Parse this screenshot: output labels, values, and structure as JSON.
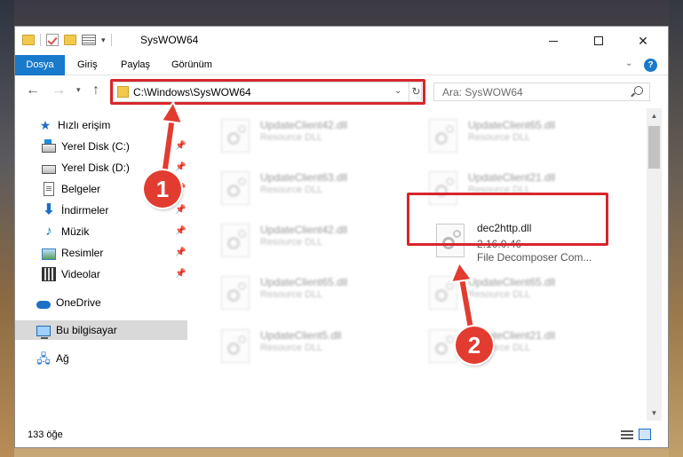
{
  "window": {
    "title": "SysWOW64",
    "controls": {
      "minimize": "minimize",
      "maximize": "maximize",
      "close": "close"
    }
  },
  "ribbon": {
    "tabs": [
      {
        "label": "Dosya"
      },
      {
        "label": "Giriş"
      },
      {
        "label": "Paylaş"
      },
      {
        "label": "Görünüm"
      }
    ],
    "help": "?"
  },
  "nav": {
    "address": "C:\\Windows\\SysWOW64",
    "search_placeholder": "Ara: SysWOW64"
  },
  "sidebar": {
    "items": [
      {
        "label": "Hızlı erişim"
      },
      {
        "label": "Yerel Disk (C:)"
      },
      {
        "label": "Yerel Disk (D:)"
      },
      {
        "label": "Belgeler"
      },
      {
        "label": "İndirmeler"
      },
      {
        "label": "Müzik"
      },
      {
        "label": "Resimler"
      },
      {
        "label": "Videolar"
      },
      {
        "label": "OneDrive"
      },
      {
        "label": "Bu bilgisayar"
      },
      {
        "label": "Ağ"
      }
    ]
  },
  "files": [
    {
      "name": "UpdateClient42.dll",
      "type": "Resource DLL"
    },
    {
      "name": "UpdateClient65.dll",
      "type": "Resource DLL"
    },
    {
      "name": "UpdateClient63.dll",
      "type": "Resource DLL"
    },
    {
      "name": "UpdateClient21.dll",
      "type": "Resource DLL"
    },
    {
      "name": "UpdateClient42.dll",
      "type": "Resource DLL"
    },
    {
      "name": "dec2http.dll",
      "version": "2.16.0.46",
      "type": "File Decomposer Com..."
    },
    {
      "name": "UpdateClient65.dll",
      "type": "Resource DLL"
    },
    {
      "name": "UpdateClient65.dll",
      "type": "Resource DLL"
    },
    {
      "name": "UpdateClient5.dll",
      "type": "Resource DLL"
    },
    {
      "name": "UpdateClient21.dll",
      "type": "Resource DLL"
    }
  ],
  "status": {
    "count": "133 öğe"
  },
  "markers": {
    "one": "1",
    "two": "2"
  },
  "colors": {
    "accent": "#1979ca",
    "highlight": "#d7262b",
    "marker": "#e23c30"
  }
}
